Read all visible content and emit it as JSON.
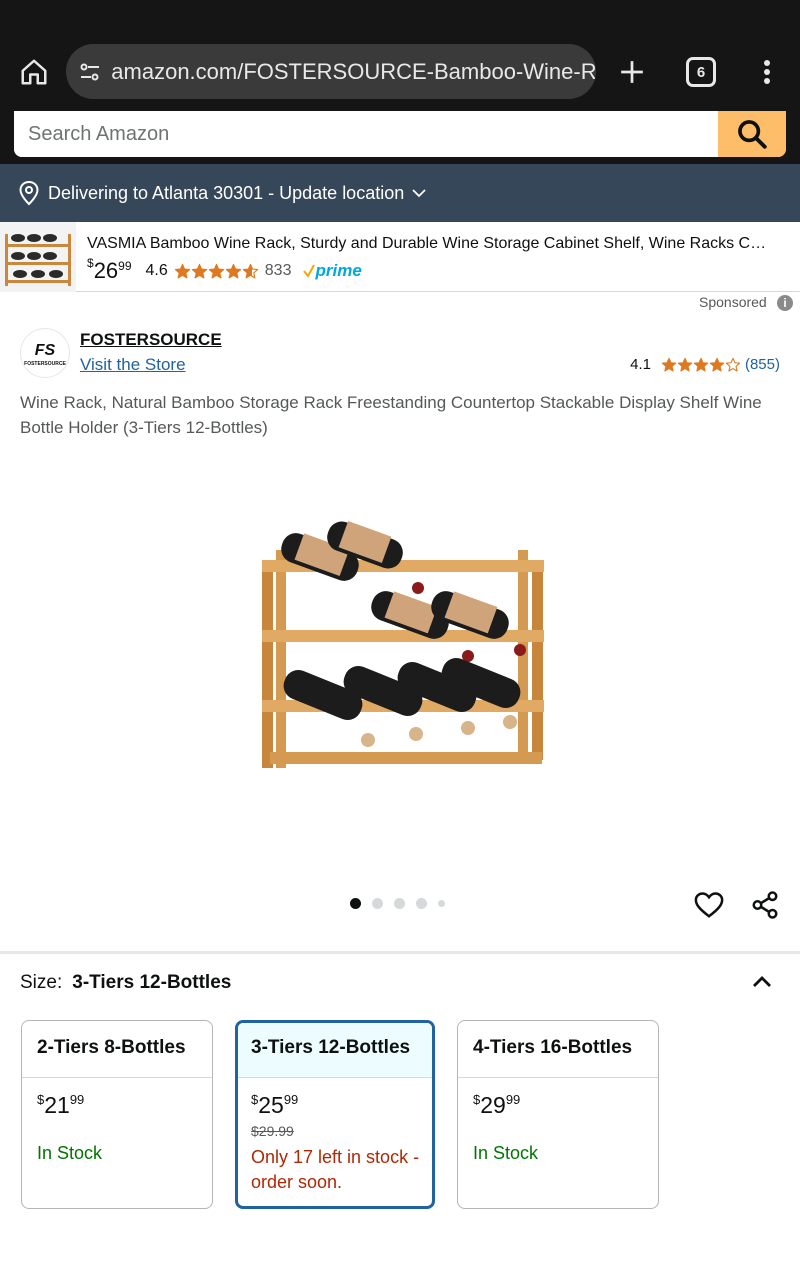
{
  "browser": {
    "url": "amazon.com/FOSTERSOURCE-Bamboo-Wine-Ra",
    "tab_count": "6"
  },
  "search": {
    "placeholder": "Search Amazon"
  },
  "location": {
    "text": "Delivering to Atlanta 30301 - Update location"
  },
  "sponsored_product": {
    "title": "VASMIA Bamboo Wine Rack, Sturdy and Durable Wine Storage Cabinet Shelf, Wine Racks C…",
    "price_symbol": "$",
    "price_whole": "26",
    "price_fraction": "99",
    "rating": "4.6",
    "rating_stars": 4.6,
    "review_count": "833",
    "prime_label": "prime"
  },
  "sponsored_label": "Sponsored",
  "brand": {
    "name": "FOSTERSOURCE",
    "logo_text": "FS",
    "logo_subtext": "FOSTERSOURCE",
    "visit_store": "Visit the Store",
    "rating": "4.1",
    "rating_stars": 4.1,
    "review_count": "(855)"
  },
  "product": {
    "title": "Wine Rack, Natural Bamboo Storage Rack Freestanding Countertop Stackable Display Shelf Wine Bottle Holder (3-Tiers 12-Bottles)",
    "image_count": 5,
    "active_image": 1
  },
  "size_selector": {
    "label": "Size:",
    "selected_value": "3-Tiers 12-Bottles",
    "options": [
      {
        "name": "2-Tiers 8-Bottles",
        "price_symbol": "$",
        "price_whole": "21",
        "price_fraction": "99",
        "list_price": "",
        "stock": "In Stock",
        "selected": false
      },
      {
        "name": "3-Tiers 12-Bottles",
        "price_symbol": "$",
        "price_whole": "25",
        "price_fraction": "99",
        "list_price": "$29.99",
        "stock": "Only 17 left in stock - order soon.",
        "selected": true
      },
      {
        "name": "4-Tiers 16-Bottles",
        "price_symbol": "$",
        "price_whole": "29",
        "price_fraction": "99",
        "list_price": "",
        "stock": "In Stock",
        "selected": false
      }
    ]
  },
  "colors": {
    "browser_bg": "#151515",
    "location_bar": "#37475a",
    "search_button": "#febd69",
    "link": "#2162a1",
    "star": "#de7921",
    "in_stock": "#007600",
    "low_stock": "#b12704",
    "selected_border": "#2162a1"
  }
}
